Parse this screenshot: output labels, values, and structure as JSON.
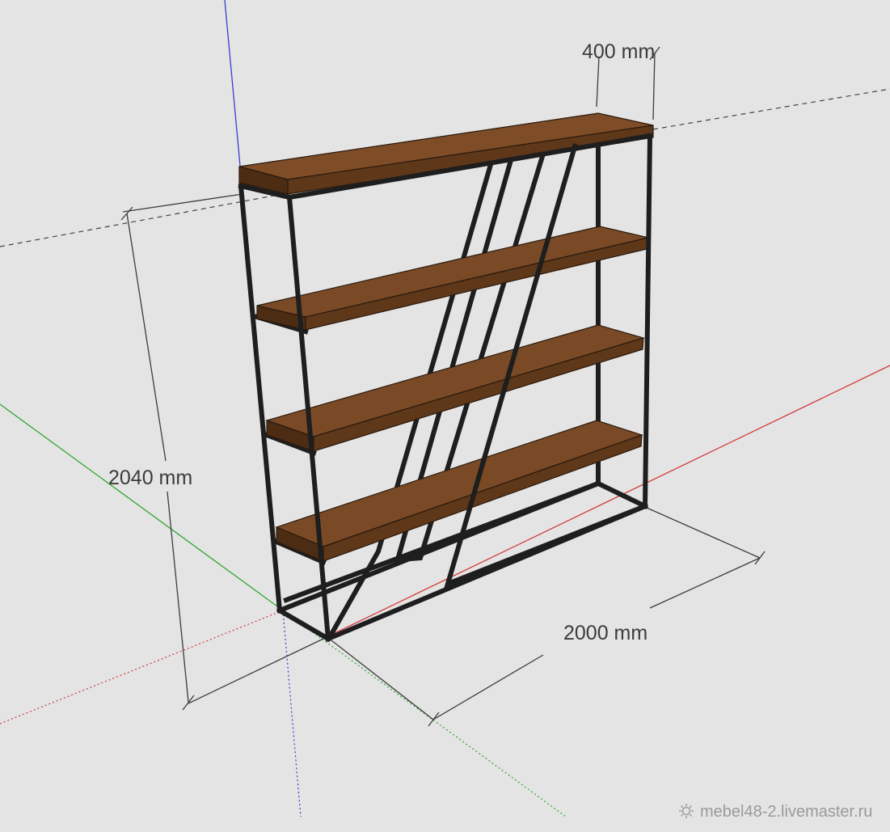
{
  "dimensions": {
    "depth_label": "400 mm",
    "height_label": "2040 mm",
    "width_label": "2000 mm"
  },
  "watermark": "mebel48-2.livemaster.ru",
  "colors": {
    "background": "#e4e4e4",
    "frame": "#1e1e1e",
    "shelf_top": "#7a4a26",
    "shelf_front": "#5f3719",
    "axis_red": "#d23a3a",
    "axis_green": "#2fa52f",
    "axis_blue": "#3a3ad2",
    "dim_line": "#3c3c3c"
  },
  "icons": [
    "watermark-gear-icon"
  ]
}
